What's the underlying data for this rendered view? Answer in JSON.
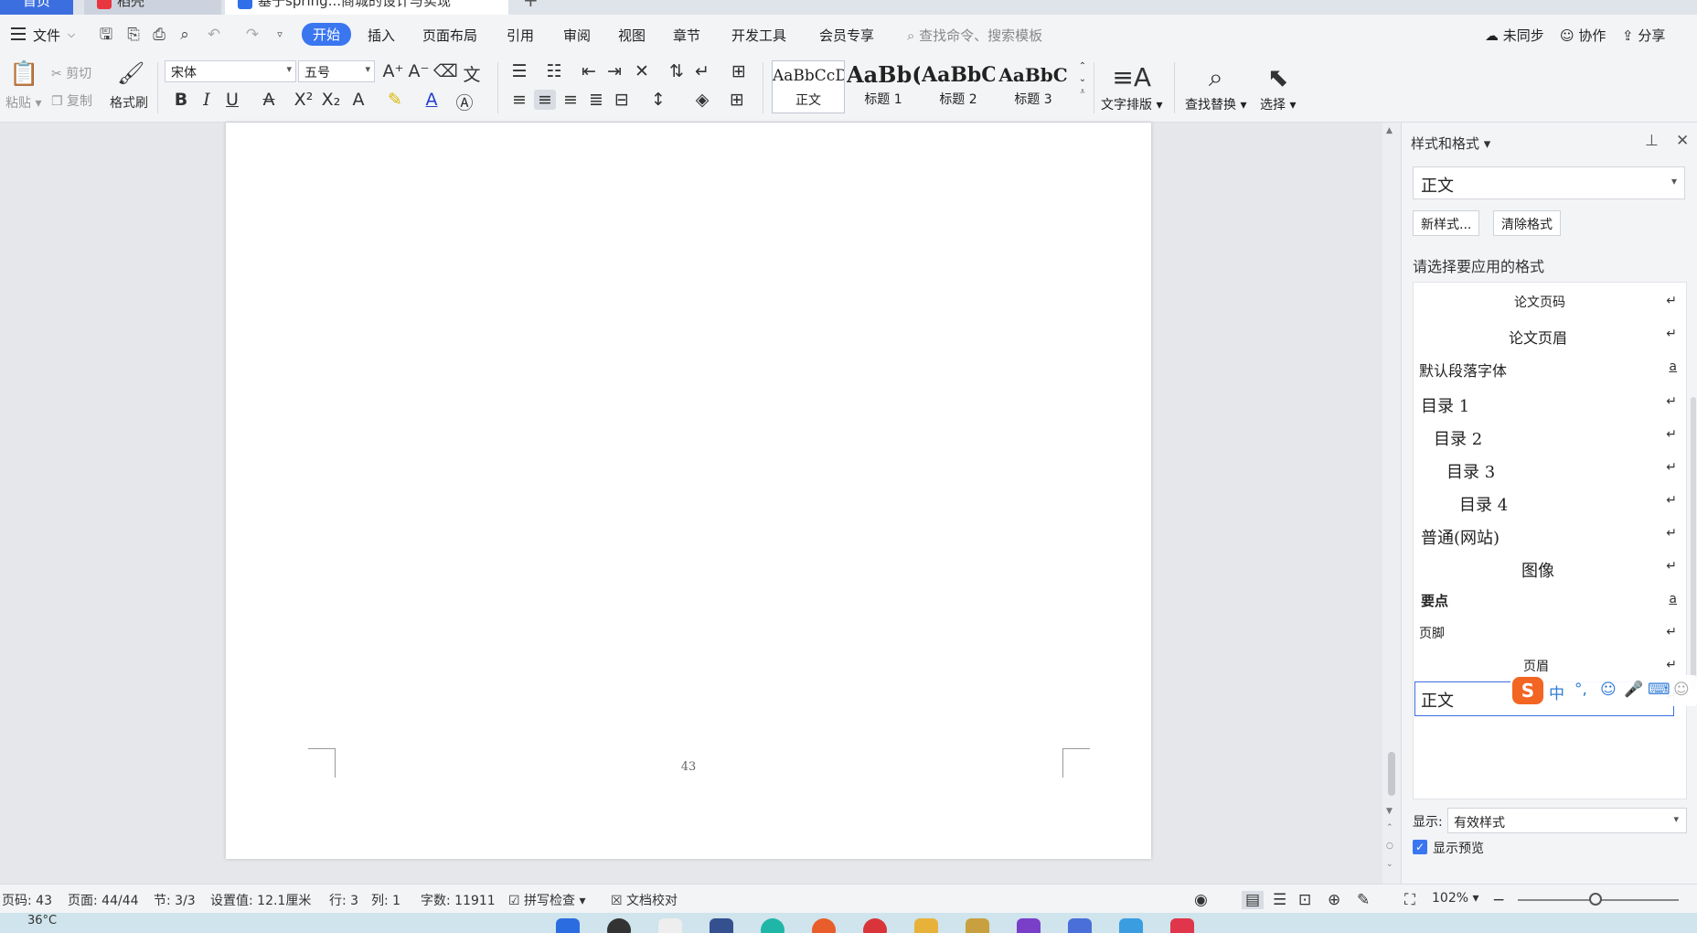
{
  "titlebar": {
    "tabs": [
      {
        "label": "首页"
      },
      {
        "label": "稻壳"
      },
      {
        "label": "基于spring...商城的设计与实现"
      }
    ],
    "new_tab": "+"
  },
  "menu": {
    "file": "文件",
    "tabs": [
      "开始",
      "插入",
      "页面布局",
      "引用",
      "审阅",
      "视图",
      "章节",
      "开发工具",
      "会员专享"
    ],
    "active_tab": "开始",
    "search_placeholder": "查找命令、搜索模板",
    "right": {
      "sync": "未同步",
      "collab": "协作",
      "share": "分享"
    }
  },
  "ribbon": {
    "clipboard": {
      "paste": "粘贴",
      "cut": "剪切",
      "copy": "复制",
      "format_painter": "格式刷"
    },
    "font": {
      "name": "宋体",
      "size": "五号"
    },
    "styles": [
      {
        "preview": "AaBbCcD",
        "label": "正文"
      },
      {
        "preview": "AaBb(",
        "label": "标题 1"
      },
      {
        "preview": "AaBbC",
        "label": "标题 2"
      },
      {
        "preview": "AaBbC",
        "label": "标题 3"
      }
    ],
    "text_layout": "文字排版",
    "find_replace": "查找替换",
    "select": "选择"
  },
  "document": {
    "page_number": "43"
  },
  "pane": {
    "title": "样式和格式",
    "current_style": "正文",
    "new_style": "新样式...",
    "clear_format": "清除格式",
    "prompt": "请选择要应用的格式",
    "styles": [
      {
        "name": "论文页码",
        "mark": "↵"
      },
      {
        "name": "论文页眉",
        "mark": "↵"
      },
      {
        "name": "默认段落字体",
        "mark": "a"
      },
      {
        "name": "目录 1",
        "mark": "↵"
      },
      {
        "name": "目录 2",
        "mark": "↵"
      },
      {
        "name": "目录 3",
        "mark": "↵"
      },
      {
        "name": "目录 4",
        "mark": "↵"
      },
      {
        "name": "普通(网站)",
        "mark": "↵"
      },
      {
        "name": "图像",
        "mark": "↵"
      },
      {
        "name": "要点",
        "mark": "a"
      },
      {
        "name": "页脚",
        "mark": "↵"
      },
      {
        "name": "页眉",
        "mark": "↵"
      },
      {
        "name": "正文",
        "mark": "↵"
      }
    ],
    "show_label": "显示:",
    "show_value": "有效样式",
    "preview_label": "显示预览"
  },
  "ime": {
    "logo": "S",
    "mode": "中"
  },
  "status": {
    "page_code": "页码: 43",
    "page": "页面: 44/44",
    "section": "节: 3/3",
    "setting": "设置值: 12.1厘米",
    "line": "行: 3",
    "col": "列: 1",
    "words": "字数: 11911",
    "spell": "拼写检查",
    "proof": "文档校对",
    "zoom": "102%"
  },
  "taskbar": {
    "weather": "36°C"
  },
  "colors": {
    "accent": "#3a76f0",
    "ime": "#f26522"
  }
}
